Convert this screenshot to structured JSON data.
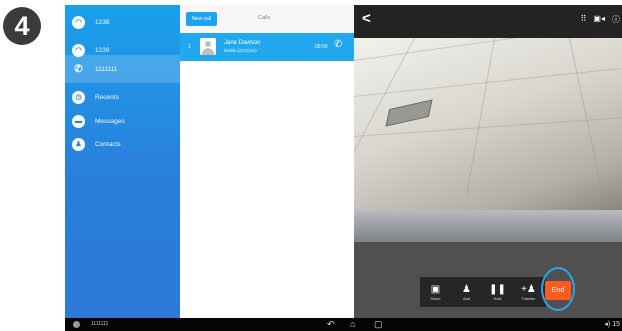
{
  "step_badge": "4",
  "sidebar": {
    "items": [
      {
        "label": "1238",
        "icon": "hangup-icon"
      },
      {
        "label": "1239",
        "icon": "hangup-icon"
      },
      {
        "label": "1111111",
        "icon": "phone-icon",
        "active": true
      },
      {
        "label": "Recents",
        "icon": "clock-icon"
      },
      {
        "label": "Messages",
        "icon": "message-icon"
      },
      {
        "label": "Contacts",
        "icon": "person-icon"
      }
    ]
  },
  "calls_panel": {
    "new_call_label": "New call",
    "title": "Calls",
    "active_call": {
      "index": "1",
      "name": "Jane Dawson",
      "detail": "Mobile (2222222)",
      "duration": "00:00"
    }
  },
  "video": {
    "controls": [
      {
        "label": "Share",
        "glyph": "▣"
      },
      {
        "label": "Add",
        "glyph": "♟"
      },
      {
        "label": "Hold",
        "glyph": "❚❚"
      },
      {
        "label": "Transfer",
        "glyph": "+♟"
      }
    ],
    "end_label": "End"
  },
  "system_bar": {
    "number": "1111111",
    "clock": "15"
  },
  "colors": {
    "sidebar": "#2a8ee6",
    "accent": "#22a8ef",
    "end_button": "#ff5a1f",
    "highlight_ring": "#2aa5ec"
  }
}
